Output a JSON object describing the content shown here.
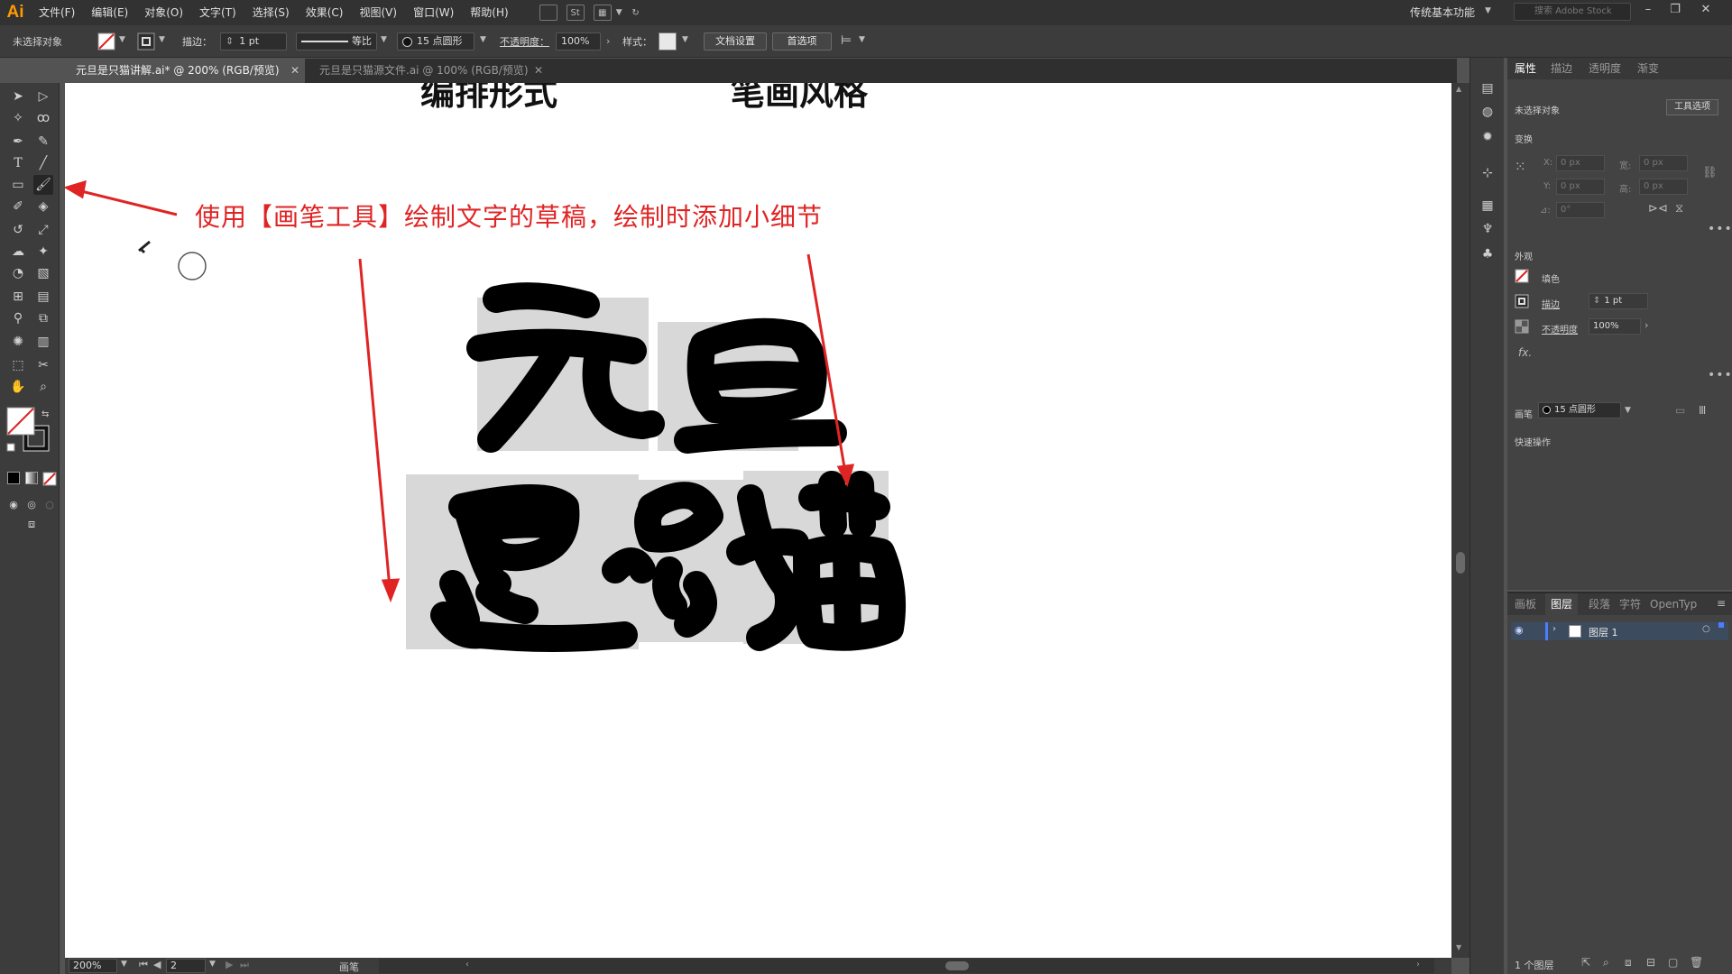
{
  "app": {
    "logo": "Ai"
  },
  "menu": [
    "文件(F)",
    "编辑(E)",
    "对象(O)",
    "文字(T)",
    "选择(S)",
    "效果(C)",
    "视图(V)",
    "窗口(W)",
    "帮助(H)"
  ],
  "menubar_icons": {
    "st": "St"
  },
  "workspace": "传统基本功能",
  "stock_search_placeholder": "搜索 Adobe Stock",
  "control": {
    "no_selection": "未选择对象",
    "stroke_label": "描边：",
    "stroke_value": "1 pt",
    "profile": "等比",
    "brush": "15 点圆形",
    "opacity_label": "不透明度：",
    "opacity_value": "100%",
    "style_label": "样式：",
    "doc_setup": "文档设置",
    "preferences": "首选项"
  },
  "tabs": [
    {
      "label": "元旦是只猫讲解.ai* @ 200% (RGB/预览)",
      "active": true
    },
    {
      "label": "元旦是只猫源文件.ai @ 100% (RGB/预览)",
      "active": false
    }
  ],
  "canvas": {
    "heading_left": "编排形式",
    "heading_right": "笔画风格",
    "annotation": "使用【画笔工具】绘制文字的草稿，绘制时添加小细节",
    "annotation_color": "#e02424"
  },
  "properties": {
    "tabs": [
      "属性",
      "描边",
      "透明度",
      "渐变"
    ],
    "selection": "未选择对象",
    "tool_options": "工具选项",
    "transform_title": "变换",
    "x_label": "X:",
    "y_label": "Y:",
    "w_label": "宽:",
    "h_label": "高:",
    "field_value": "0 px",
    "angle_label": "⊿:",
    "angle_value": "0°",
    "appearance_title": "外观",
    "fill_label": "填色",
    "stroke_label": "描边",
    "stroke_value": "1 pt",
    "opacity_label": "不透明度",
    "opacity_value": "100%",
    "fx": "fx.",
    "brush_label": "画笔",
    "brush_value": "15 点圆形",
    "quick_actions": "快速操作"
  },
  "layers": {
    "tabs": [
      "画板",
      "图层",
      "段落",
      "字符",
      "OpenTyp"
    ],
    "active_tab": "图层",
    "layer_name": "图层 1",
    "count": "1 个图层"
  },
  "status": {
    "zoom": "200%",
    "artboard": "2",
    "tool": "画笔"
  },
  "colors": {
    "ui_dark": "#323232",
    "panel": "#434343",
    "accent_orange": "#ff9a00",
    "arrow_red": "#e02424"
  }
}
